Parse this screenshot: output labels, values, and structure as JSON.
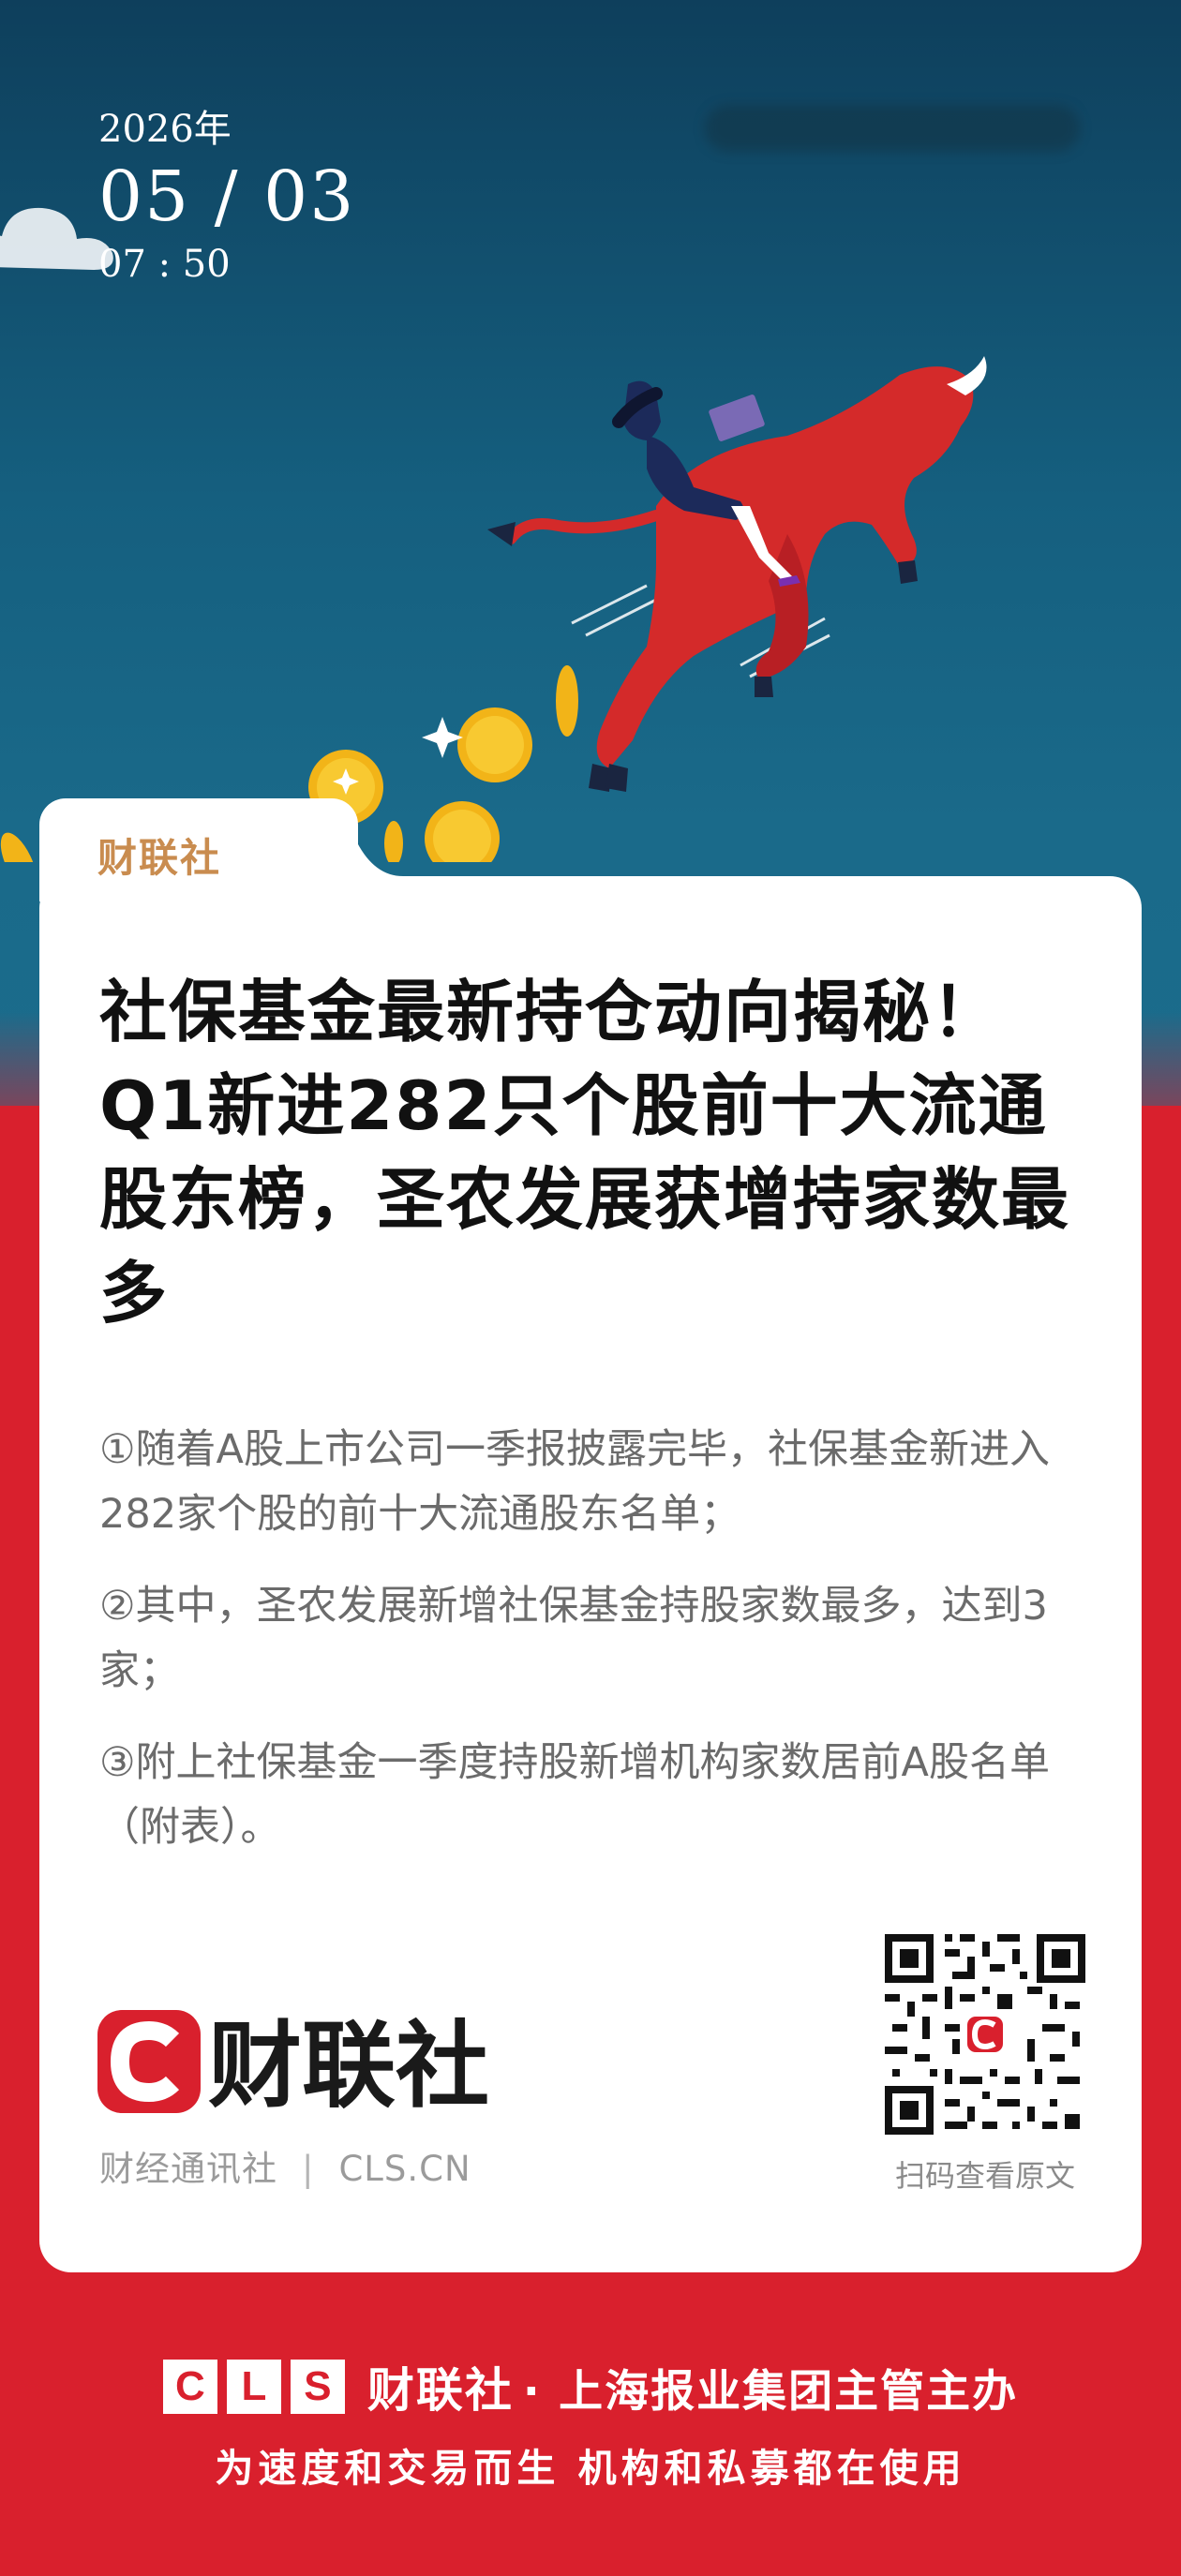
{
  "header": {
    "year": "2026年",
    "day": "05 / 03",
    "time": "07 : 50"
  },
  "card": {
    "tab_label": "财联社",
    "headline": "社保基金最新持仓动向揭秘！Q1新进282只个股前十大流通股东榜，圣农发展获增持家数最多",
    "summary": [
      "①随着A股上市公司一季报披露完毕，社保基金新进入282家个股的前十大流通股东名单；",
      "②其中，圣农发展新增社保基金持股家数最多，达到3家；",
      "③附上社保基金一季度持股新增机构家数居前A股名单（附表）。"
    ],
    "logo_text": "财联社",
    "footer_left": "财经通讯社",
    "footer_sep": "|",
    "footer_right": "CLS.CN",
    "qr_caption": "扫码查看原文"
  },
  "bottom": {
    "cls_letters": [
      "C",
      "L",
      "S"
    ],
    "brand": "财联社",
    "line1_text": "· 上海报业集团主管主办",
    "line2": "为速度和交易而生 机构和私募都在使用"
  },
  "colors": {
    "brand_red": "#d9202d",
    "hero_blue": "#155f7f",
    "tab_gold": "#c98c4f"
  }
}
